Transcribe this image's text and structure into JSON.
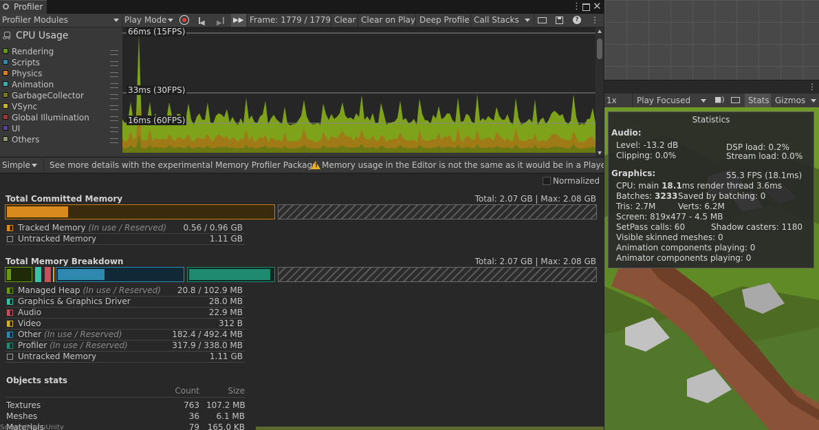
{
  "window": {
    "tab_title": "Profiler"
  },
  "toolbar": {
    "modules_dropdown": "Profiler Modules",
    "play_mode": "Play Mode",
    "frame_label": "Frame: 1779 / 1779",
    "clear": "Clear",
    "clear_on_play": "Clear on Play",
    "deep_profile": "Deep Profile",
    "call_stacks": "Call Stacks"
  },
  "cpu_module": {
    "title": "CPU Usage",
    "icon_label": "CPU",
    "items": [
      {
        "label": "Rendering",
        "color": "#6a9a13"
      },
      {
        "label": "Scripts",
        "color": "#2e88b0"
      },
      {
        "label": "Physics",
        "color": "#e07b16"
      },
      {
        "label": "Animation",
        "color": "#33b0b6"
      },
      {
        "label": "GarbageCollector",
        "color": "#7a7a1a"
      },
      {
        "label": "VSync",
        "color": "#c9b124"
      },
      {
        "label": "Global Illumination",
        "color": "#a13a2a"
      },
      {
        "label": "UI",
        "color": "#5a3f9c"
      },
      {
        "label": "Others",
        "color": "#8d9a6a"
      }
    ]
  },
  "chart": {
    "line_66": "66ms (15FPS)",
    "line_33": "33ms (30FPS)",
    "line_16": "16ms (60FPS)"
  },
  "memory_toolbar": {
    "view_mode": "Simple",
    "memory_profiler_link": "See more details with the experimental Memory Profiler Package.",
    "warning": "Memory usage in the Editor is not the same as it would be in a Player",
    "normalized": "Normalized"
  },
  "committed": {
    "title": "Total Committed Memory",
    "total": "Total: 2.07 GB | Max: 2.08 GB",
    "fraction_tracked": 0.27,
    "legend": [
      {
        "label": "Tracked Memory",
        "sub": "(In use / Reserved)",
        "value": "0.56 / 0.96 GB",
        "color": "#e08a1a"
      },
      {
        "label": "Untracked Memory",
        "sub": "",
        "value": "1.11 GB",
        "color": "none"
      }
    ]
  },
  "breakdown": {
    "title": "Total Memory Breakdown",
    "total": "Total: 2.07 GB | Max: 2.08 GB",
    "legend": [
      {
        "label": "Managed Heap",
        "sub": "(In use / Reserved)",
        "value": "20.8 / 102.9 MB",
        "color": "#6a9a13"
      },
      {
        "label": "Graphics & Graphics Driver",
        "sub": "",
        "value": "28.0 MB",
        "color": "#36c2a6"
      },
      {
        "label": "Audio",
        "sub": "",
        "value": "22.9 MB",
        "color": "#c9505a"
      },
      {
        "label": "Video",
        "sub": "",
        "value": "312 B",
        "color": "#d8b028"
      },
      {
        "label": "Other",
        "sub": "(In use / Reserved)",
        "value": "182.4 / 492.4 MB",
        "color": "#2e88b0"
      },
      {
        "label": "Profiler",
        "sub": "(In use / Reserved)",
        "value": "317.9 / 338.0 MB",
        "color": "#1f8a70"
      },
      {
        "label": "Untracked Memory",
        "sub": "",
        "value": "1.11 GB",
        "color": "none"
      }
    ]
  },
  "objects": {
    "title": "Objects stats",
    "col_count": "Count",
    "col_size": "Size",
    "rows": [
      {
        "name": "Textures",
        "count": "763",
        "size": "107.2 MB"
      },
      {
        "name": "Meshes",
        "count": "36",
        "size": "6.1 MB"
      },
      {
        "name": "Materials",
        "count": "79",
        "size": "165.0 KB"
      }
    ]
  },
  "game_view": {
    "scale": "1x",
    "play_focused": "Play Focused",
    "stats_tab": "Stats",
    "gizmos": "Gizmos"
  },
  "statistics": {
    "title": "Statistics",
    "audio_header": "Audio:",
    "level": "Level: -13.2 dB",
    "dsp": "DSP load: 0.2%",
    "clipping": "Clipping: 0.0%",
    "stream": "Stream load: 0.0%",
    "graphics_header": "Graphics:",
    "fps": "55.3 FPS (18.1ms)",
    "cpu_prefix": "CPU: main ",
    "cpu_main": "18.1",
    "cpu_suffix": "ms  render thread 3.6ms",
    "batches_prefix": "Batches: ",
    "batches": "3233",
    "saved_batching": "Saved by batching: 0",
    "tris": "Tris: 2.7M",
    "verts": "Verts: 6.2M",
    "screen": "Screen: 819x477 - 4.5 MB",
    "setpass": "SetPass calls: 60",
    "shadow_casters": "Shadow casters: 1180",
    "skinned": "Visible skinned meshes: 0",
    "anim_components": "Animation components playing: 0",
    "animator_components": "Animator components playing: 0"
  },
  "footer": {
    "clipped_text": "Scenes/MenuUnity"
  }
}
